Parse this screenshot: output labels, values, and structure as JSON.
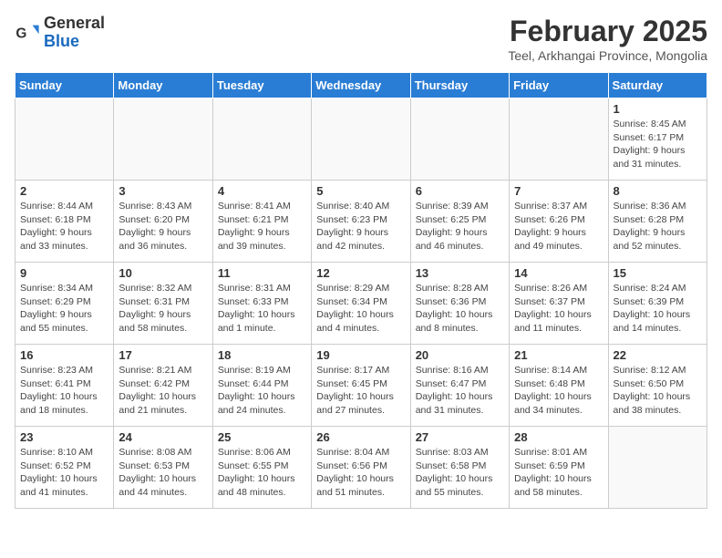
{
  "header": {
    "logo_general": "General",
    "logo_blue": "Blue",
    "month_year": "February 2025",
    "location": "Teel, Arkhangai Province, Mongolia"
  },
  "days_of_week": [
    "Sunday",
    "Monday",
    "Tuesday",
    "Wednesday",
    "Thursday",
    "Friday",
    "Saturday"
  ],
  "weeks": [
    [
      {
        "day": "",
        "info": ""
      },
      {
        "day": "",
        "info": ""
      },
      {
        "day": "",
        "info": ""
      },
      {
        "day": "",
        "info": ""
      },
      {
        "day": "",
        "info": ""
      },
      {
        "day": "",
        "info": ""
      },
      {
        "day": "1",
        "info": "Sunrise: 8:45 AM\nSunset: 6:17 PM\nDaylight: 9 hours and 31 minutes."
      }
    ],
    [
      {
        "day": "2",
        "info": "Sunrise: 8:44 AM\nSunset: 6:18 PM\nDaylight: 9 hours and 33 minutes."
      },
      {
        "day": "3",
        "info": "Sunrise: 8:43 AM\nSunset: 6:20 PM\nDaylight: 9 hours and 36 minutes."
      },
      {
        "day": "4",
        "info": "Sunrise: 8:41 AM\nSunset: 6:21 PM\nDaylight: 9 hours and 39 minutes."
      },
      {
        "day": "5",
        "info": "Sunrise: 8:40 AM\nSunset: 6:23 PM\nDaylight: 9 hours and 42 minutes."
      },
      {
        "day": "6",
        "info": "Sunrise: 8:39 AM\nSunset: 6:25 PM\nDaylight: 9 hours and 46 minutes."
      },
      {
        "day": "7",
        "info": "Sunrise: 8:37 AM\nSunset: 6:26 PM\nDaylight: 9 hours and 49 minutes."
      },
      {
        "day": "8",
        "info": "Sunrise: 8:36 AM\nSunset: 6:28 PM\nDaylight: 9 hours and 52 minutes."
      }
    ],
    [
      {
        "day": "9",
        "info": "Sunrise: 8:34 AM\nSunset: 6:29 PM\nDaylight: 9 hours and 55 minutes."
      },
      {
        "day": "10",
        "info": "Sunrise: 8:32 AM\nSunset: 6:31 PM\nDaylight: 9 hours and 58 minutes."
      },
      {
        "day": "11",
        "info": "Sunrise: 8:31 AM\nSunset: 6:33 PM\nDaylight: 10 hours and 1 minute."
      },
      {
        "day": "12",
        "info": "Sunrise: 8:29 AM\nSunset: 6:34 PM\nDaylight: 10 hours and 4 minutes."
      },
      {
        "day": "13",
        "info": "Sunrise: 8:28 AM\nSunset: 6:36 PM\nDaylight: 10 hours and 8 minutes."
      },
      {
        "day": "14",
        "info": "Sunrise: 8:26 AM\nSunset: 6:37 PM\nDaylight: 10 hours and 11 minutes."
      },
      {
        "day": "15",
        "info": "Sunrise: 8:24 AM\nSunset: 6:39 PM\nDaylight: 10 hours and 14 minutes."
      }
    ],
    [
      {
        "day": "16",
        "info": "Sunrise: 8:23 AM\nSunset: 6:41 PM\nDaylight: 10 hours and 18 minutes."
      },
      {
        "day": "17",
        "info": "Sunrise: 8:21 AM\nSunset: 6:42 PM\nDaylight: 10 hours and 21 minutes."
      },
      {
        "day": "18",
        "info": "Sunrise: 8:19 AM\nSunset: 6:44 PM\nDaylight: 10 hours and 24 minutes."
      },
      {
        "day": "19",
        "info": "Sunrise: 8:17 AM\nSunset: 6:45 PM\nDaylight: 10 hours and 27 minutes."
      },
      {
        "day": "20",
        "info": "Sunrise: 8:16 AM\nSunset: 6:47 PM\nDaylight: 10 hours and 31 minutes."
      },
      {
        "day": "21",
        "info": "Sunrise: 8:14 AM\nSunset: 6:48 PM\nDaylight: 10 hours and 34 minutes."
      },
      {
        "day": "22",
        "info": "Sunrise: 8:12 AM\nSunset: 6:50 PM\nDaylight: 10 hours and 38 minutes."
      }
    ],
    [
      {
        "day": "23",
        "info": "Sunrise: 8:10 AM\nSunset: 6:52 PM\nDaylight: 10 hours and 41 minutes."
      },
      {
        "day": "24",
        "info": "Sunrise: 8:08 AM\nSunset: 6:53 PM\nDaylight: 10 hours and 44 minutes."
      },
      {
        "day": "25",
        "info": "Sunrise: 8:06 AM\nSunset: 6:55 PM\nDaylight: 10 hours and 48 minutes."
      },
      {
        "day": "26",
        "info": "Sunrise: 8:04 AM\nSunset: 6:56 PM\nDaylight: 10 hours and 51 minutes."
      },
      {
        "day": "27",
        "info": "Sunrise: 8:03 AM\nSunset: 6:58 PM\nDaylight: 10 hours and 55 minutes."
      },
      {
        "day": "28",
        "info": "Sunrise: 8:01 AM\nSunset: 6:59 PM\nDaylight: 10 hours and 58 minutes."
      },
      {
        "day": "",
        "info": ""
      }
    ]
  ]
}
